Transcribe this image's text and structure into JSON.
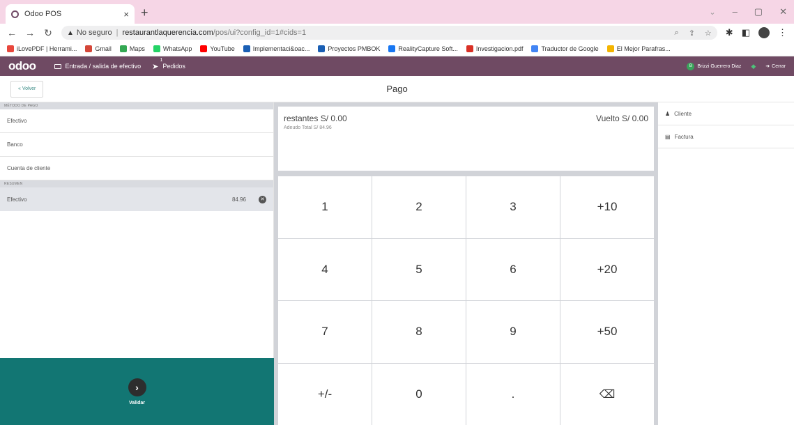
{
  "browser": {
    "tab_title": "Odoo POS",
    "tab_close": "×",
    "new_tab": "+",
    "security_label": "No seguro",
    "url_host": "restaurantlaquerencia.com",
    "url_path": "/pos/ui?config_id=1#cids=1",
    "bookmarks": [
      {
        "label": "iLovePDF | Herrami...",
        "color": "#e8473c"
      },
      {
        "label": "Gmail",
        "color": "#d44638"
      },
      {
        "label": "Maps",
        "color": "#34a853"
      },
      {
        "label": "WhatsApp",
        "color": "#25d366"
      },
      {
        "label": "YouTube",
        "color": "#ff0000"
      },
      {
        "label": "Implementaci&oac...",
        "color": "#1a5fb4"
      },
      {
        "label": "Proyectos PMBOK",
        "color": "#1a5fb4"
      },
      {
        "label": "RealityCapture Soft...",
        "color": "#1877f2"
      },
      {
        "label": "Investigacion.pdf",
        "color": "#d93025"
      },
      {
        "label": "Traductor de Google",
        "color": "#4285f4"
      },
      {
        "label": "El Mejor Parafras...",
        "color": "#f4b400"
      }
    ]
  },
  "navbar": {
    "logo": "odoo",
    "cash_in_out": "Entrada / salida de efectivo",
    "orders": "Pedidos",
    "orders_count": "1",
    "cashier_initial": "B",
    "cashier_name": "Brizzi Guerrero Diaz",
    "close": "Cerrar",
    "accent": "#6f4a63"
  },
  "payment": {
    "back_label": "« Volver",
    "title": "Pago",
    "methods_header": "MÉTODO DE PAGO",
    "methods": [
      "Efectivo",
      "Banco",
      "Cuenta de cliente"
    ],
    "summary_header": "RESUMEN",
    "lines": [
      {
        "method": "Efectivo",
        "amount": "84.96"
      }
    ],
    "validate_label": "Validar",
    "remaining": "restantes S/ 0.00",
    "change": "Vuelto S/ 0.00",
    "total_due": "Adeudo Total S/ 84.96",
    "numpad": [
      "1",
      "2",
      "3",
      "+10",
      "4",
      "5",
      "6",
      "+20",
      "7",
      "8",
      "9",
      "+50",
      "+/-",
      "0",
      ".",
      "⌫"
    ],
    "customer": "Cliente",
    "invoice": "Factura",
    "validate_color": "#127673"
  }
}
